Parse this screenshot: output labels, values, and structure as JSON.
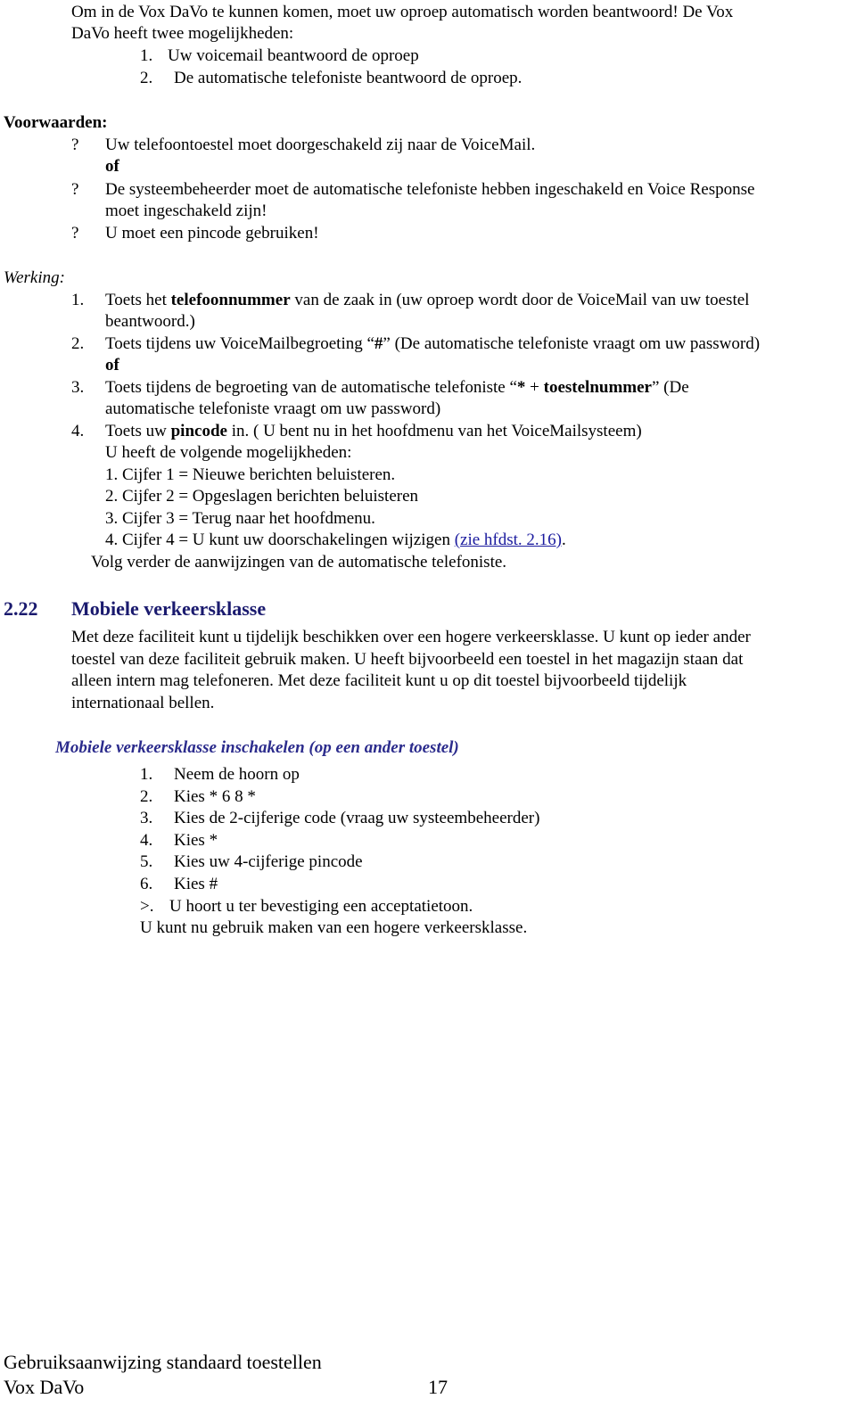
{
  "intro": {
    "line1": "Om in de Vox DaVo te kunnen komen, moet uw oproep automatisch worden beantwoord! De Vox",
    "line2": "DaVo heeft twee mogelijkheden:",
    "options": [
      {
        "num": "1.",
        "text": "Uw voicemail beantwoord de oproep"
      },
      {
        "num": "2.",
        "text": "De automatische telefoniste beantwoord de oproep."
      }
    ]
  },
  "conditions": {
    "title": "Voorwaarden:",
    "bullet": "?",
    "item1": "Uw telefoontoestel moet doorgeschakeld zij naar de VoiceMail.",
    "or1": "of",
    "item2_line1": "De systeembeheerder moet de automatische telefoniste hebben ingeschakeld en Voice Response",
    "item2_line2": "moet ingeschakeld zijn!",
    "item3_prefix": "?",
    "item3": "U moet een pincode gebruiken!"
  },
  "operation": {
    "title": "Werking:",
    "step1": {
      "num": "1.",
      "pre": "Toets het ",
      "bold": "telefoonnummer",
      "post": " van de zaak in (uw oproep wordt door de VoiceMail van uw toestel",
      "line2": "beantwoord.)"
    },
    "step2": {
      "num": "2.",
      "text": "Toets tijdens uw VoiceMailbegroeting “",
      "bold": "#",
      "post": "” (De automatische telefoniste vraagt om uw password)"
    },
    "or": "of",
    "step3": {
      "num": "3.",
      "pre": "Toets tijdens de begroeting van de automatische telefoniste “",
      "bold1": "*",
      "mid": " + ",
      "bold2": "toestelnummer",
      "post": "” (De",
      "line2": "automatische telefoniste vraagt om uw password)"
    },
    "step4": {
      "num": "4.",
      "pre": "Toets uw ",
      "bold": "pincode",
      "post": " in. ( U bent nu in het hoofdmenu van het VoiceMailsysteem)"
    },
    "options_intro": "U heeft de volgende mogelijkheden:",
    "menu": [
      "1. Cijfer 1 = Nieuwe berichten beluisteren.",
      "2. Cijfer 2 = Opgeslagen berichten beluisteren",
      "3. Cijfer 3 = Terug naar het hoofdmenu."
    ],
    "menu4_text": "4. Cijfer 4 = U kunt uw doorschakelingen wijzigen ",
    "menu4_link": "(zie hfdst. 2.16)",
    "menu4_end": ".",
    "follow": "Volg verder de aanwijzingen van de automatische telefoniste."
  },
  "section": {
    "number": "2.22",
    "title": "Mobiele verkeersklasse",
    "paragraph": [
      "Met deze faciliteit kunt u tijdelijk beschikken over een hogere verkeersklasse. U kunt op ieder ander",
      "toestel van deze faciliteit gebruik maken. U heeft bijvoorbeeld een toestel in het magazijn staan dat",
      "alleen intern mag telefoneren. Met deze faciliteit kunt u op dit toestel bijvoorbeeld tijdelijk",
      "internationaal bellen."
    ],
    "subheading": "Mobiele verkeersklasse inschakelen (op een ander toestel)",
    "steps": [
      {
        "num": "1.",
        "text": "Neem de hoorn op"
      },
      {
        "num": "2.",
        "text": "Kies * 6 8 *"
      },
      {
        "num": "3.",
        "text": "Kies de 2-cijferige code (vraag uw systeembeheerder)"
      },
      {
        "num": "4.",
        "text": "Kies *"
      },
      {
        "num": "5.",
        "text": "Kies uw 4-cijferige pincode"
      },
      {
        "num": "6.",
        "text": "Kies #"
      }
    ],
    "confirm_num": ">.",
    "confirm_text": "U hoort u ter bevestiging een acceptatietoon.",
    "closing": "U kunt nu gebruik maken van een hogere verkeersklasse."
  },
  "footer": {
    "title": "Gebruiksaanwijzing standaard toestellen",
    "product": "Vox DaVo",
    "page_number": "17"
  }
}
